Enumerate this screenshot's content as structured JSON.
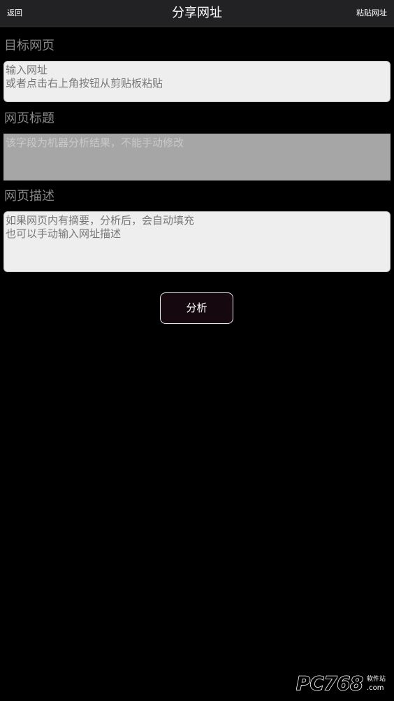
{
  "header": {
    "back_label": "返回",
    "title": "分享网址",
    "paste_label": "粘贴网址"
  },
  "target_page": {
    "label": "目标网页",
    "value": "",
    "placeholder": "输入网址\n或者点击右上角按钮从剪贴板粘贴"
  },
  "page_title": {
    "label": "网页标题",
    "value": "",
    "placeholder": "该字段为机器分析结果，不能手动修改"
  },
  "page_description": {
    "label": "网页描述",
    "value": "",
    "placeholder": "如果网页内有摘要，分析后，会自动填充\n也可以手动输入网址描述"
  },
  "analyze_button": {
    "label": "分析"
  },
  "watermark": {
    "brand": "PC768",
    "sub": "软件站",
    "suffix": ".com"
  },
  "colors": {
    "background": "#000000",
    "topbar": "#222224",
    "field": "#eeeeee",
    "field_disabled": "#a6a6a6",
    "label": "#8a8a8a",
    "button": "#15090f"
  }
}
